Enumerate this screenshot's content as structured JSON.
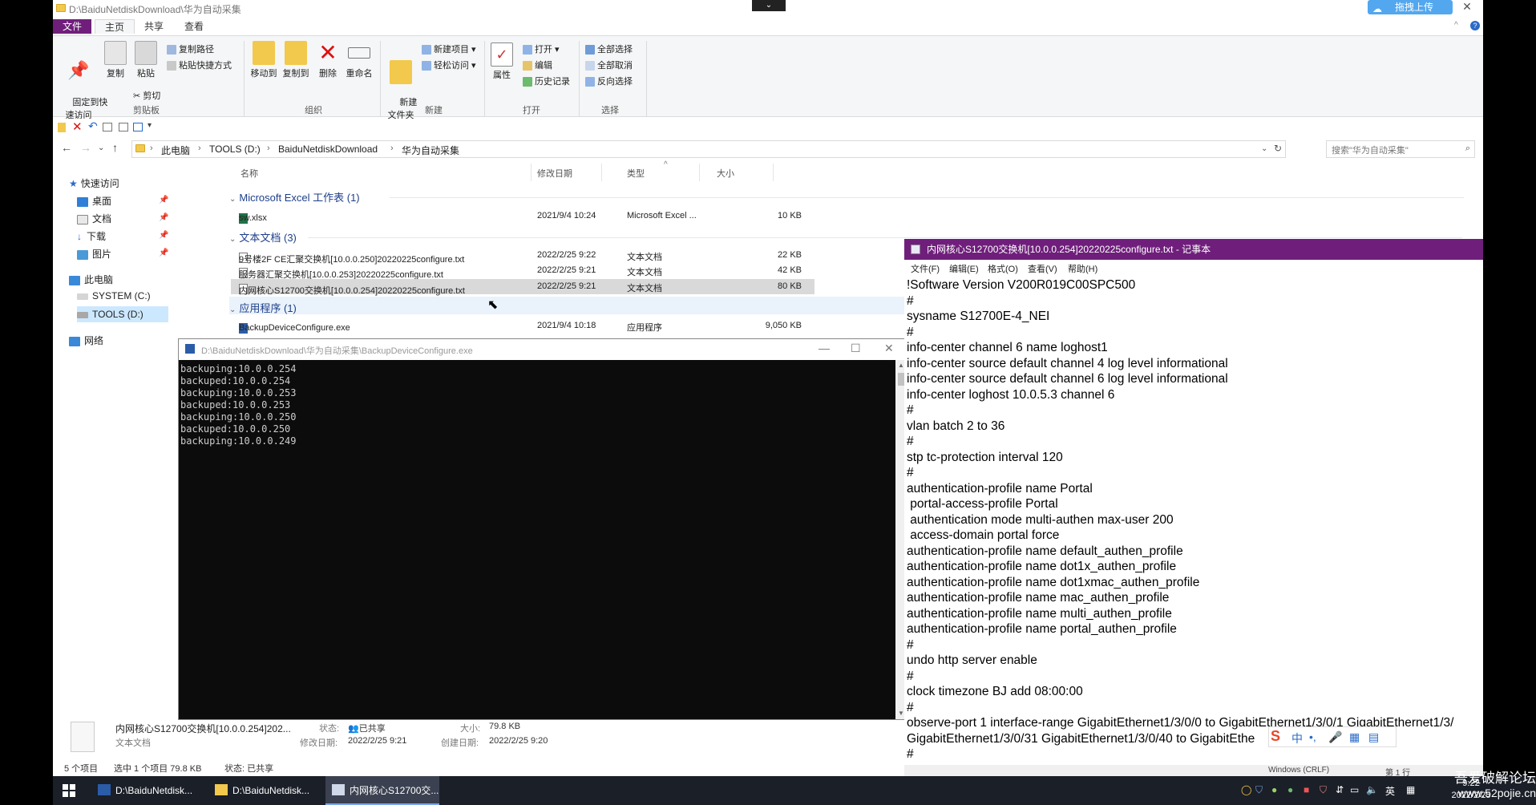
{
  "explorer": {
    "title": "D:\\BaiduNetdiskDownload\\华为自动采集",
    "baidu_upload": "拖拽上传",
    "tabs": [
      "文件",
      "主页",
      "共享",
      "查看"
    ],
    "ribbon": {
      "pin": "固定到快\n速访问",
      "copy": "复制",
      "paste": "粘贴",
      "copy_path": "复制路径",
      "paste_shortcut": "粘贴快捷方式",
      "cut": "剪切",
      "group_clipboard": "剪贴板",
      "move_to": "移动到",
      "copy_to": "复制到",
      "delete": "删除",
      "rename": "重命名",
      "group_organize": "组织",
      "new_folder": "新建\n文件夹",
      "new_item": "新建项目 ▾",
      "easy_access": "轻松访问 ▾",
      "group_new": "新建",
      "properties": "属性",
      "open": "打开 ▾",
      "edit": "编辑",
      "history": "历史记录",
      "group_open": "打开",
      "select_all": "全部选择",
      "select_none": "全部取消",
      "invert": "反向选择",
      "group_select": "选择"
    },
    "breadcrumb": [
      "此电脑",
      "TOOLS (D:)",
      "BaiduNetdiskDownload",
      "华为自动采集"
    ],
    "search_placeholder": "搜索\"华为自动采集\"",
    "nav": {
      "quick_access": "快速访问",
      "desktop": "桌面",
      "documents": "文档",
      "downloads": "下载",
      "pictures": "图片",
      "this_pc": "此电脑",
      "system_c": "SYSTEM (C:)",
      "tools_d": "TOOLS (D:)",
      "network": "网络"
    },
    "columns": {
      "name": "名称",
      "date": "修改日期",
      "type": "类型",
      "size": "大小"
    },
    "groups": {
      "excel": "Microsoft Excel 工作表 (1)",
      "text": "文本文档 (3)",
      "app": "应用程序 (1)"
    },
    "files": {
      "excel": [
        {
          "name": "sw.xlsx",
          "date": "2021/9/4 10:24",
          "type": "Microsoft Excel ...",
          "size": "10 KB"
        }
      ],
      "text": [
        {
          "name": "9号楼2F CE汇聚交换机[10.0.0.250]20220225configure.txt",
          "date": "2022/2/25 9:22",
          "type": "文本文档",
          "size": "22 KB"
        },
        {
          "name": "服务器汇聚交换机[10.0.0.253]20220225configure.txt",
          "date": "2022/2/25 9:21",
          "type": "文本文档",
          "size": "42 KB"
        },
        {
          "name": "内网核心S12700交换机[10.0.0.254]20220225configure.txt",
          "date": "2022/2/25 9:21",
          "type": "文本文档",
          "size": "80 KB"
        }
      ],
      "app": [
        {
          "name": "BackupDeviceConfigure.exe",
          "date": "2021/9/4 10:18",
          "type": "应用程序",
          "size": "9,050 KB"
        }
      ]
    },
    "details": {
      "name": "内网核心S12700交换机[10.0.0.254]202...",
      "kind": "文本文档",
      "state_label": "状态:",
      "state": "已共享",
      "size_label": "大小:",
      "size": "79.8 KB",
      "modified_label": "修改日期:",
      "modified": "2022/2/25 9:21",
      "created_label": "创建日期:",
      "created": "2022/2/25 9:20"
    },
    "status": {
      "count": "5 个项目",
      "selected": "选中 1 个项目  79.8 KB",
      "state": "状态: 已共享"
    }
  },
  "console": {
    "title": "D:\\BaiduNetdiskDownload\\华为自动采集\\BackupDeviceConfigure.exe",
    "lines": [
      "backuping:10.0.0.254",
      "backuped:10.0.0.254",
      "backuping:10.0.0.253",
      "backuped:10.0.0.253",
      "backuping:10.0.0.250",
      "backuped:10.0.0.250",
      "backuping:10.0.0.249"
    ]
  },
  "notepad": {
    "title": "内网核心S12700交换机[10.0.0.254]20220225configure.txt - 记事本",
    "menu": [
      "文件(F)",
      "编辑(E)",
      "格式(O)",
      "查看(V)",
      "帮助(H)"
    ],
    "lines": [
      "!Software Version V200R019C00SPC500",
      "#",
      "sysname S12700E-4_NEI",
      "#",
      "info-center channel 6 name loghost1",
      "info-center source default channel 4 log level informational",
      "info-center source default channel 6 log level informational",
      "info-center loghost 10.0.5.3 channel 6",
      "#",
      "vlan batch 2 to 36",
      "#",
      "stp tc-protection interval 120",
      "#",
      "authentication-profile name Portal",
      " portal-access-profile Portal",
      " authentication mode multi-authen max-user 200",
      " access-domain portal force",
      "authentication-profile name default_authen_profile",
      "authentication-profile name dot1x_authen_profile",
      "authentication-profile name dot1xmac_authen_profile",
      "authentication-profile name mac_authen_profile",
      "authentication-profile name multi_authen_profile",
      "authentication-profile name portal_authen_profile",
      "#",
      "undo http server enable",
      "#",
      "clock timezone BJ add 08:00:00",
      "#",
      "observe-port 1 interface-range GigabitEthernet1/3/0/0 to GigabitEthernet1/3/0/1 GigabitEthernet1/3/",
      "GigabitEthernet1/3/0/31 GigabitEthernet1/3/0/40 to GigabitEthe",
      "#"
    ],
    "status_encoding": "Windows (CRLF)",
    "status_pos": "第 1 行"
  },
  "ime": [
    "中",
    "•,",
    "🎤",
    "▦",
    "▤"
  ],
  "taskbar": {
    "items": [
      "D:\\BaiduNetdisk...",
      "D:\\BaiduNetdisk...",
      "内网核心S12700交..."
    ],
    "lang": "英",
    "time": "9:22",
    "date": "2022/2/25"
  },
  "watermark": {
    "text": "吾爱破解论坛",
    "url": "www.52pojie.cn"
  },
  "colors": {
    "ribbon_file_tab": "#6f1f7b",
    "notepad_title": "#6f1f7b",
    "console_bg": "#0c0c0c",
    "selection": "#d9d9d9",
    "taskbar": "#1b1f28"
  }
}
